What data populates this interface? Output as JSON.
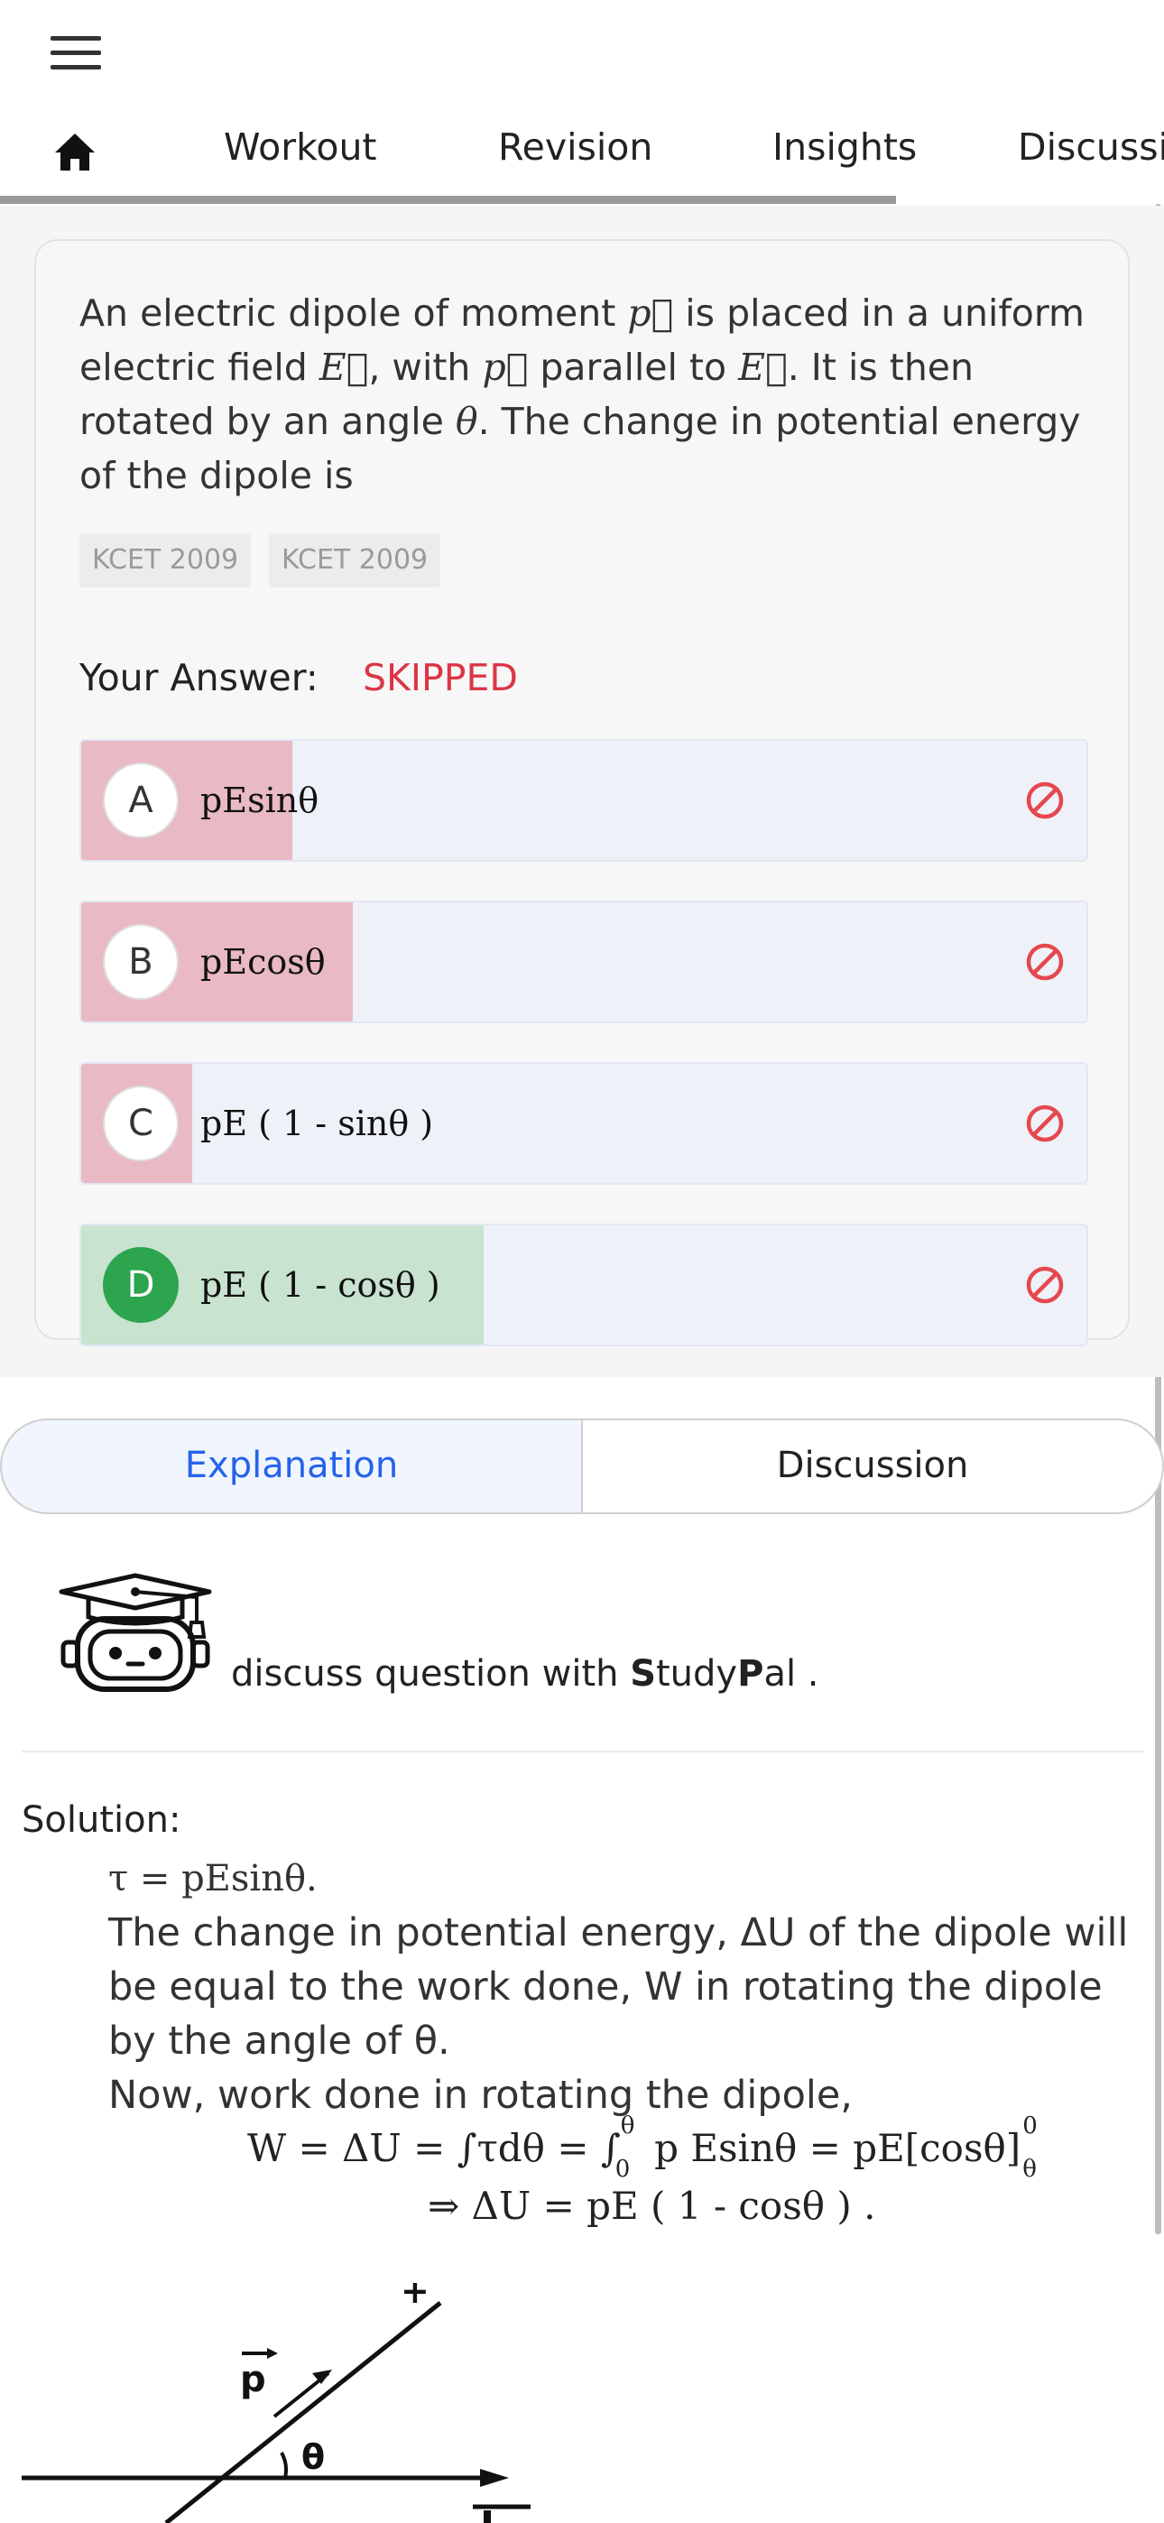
{
  "header": {
    "menu_icon": "hamburger-menu-icon",
    "home_icon": "home-icon",
    "tabs": [
      {
        "label": "Workout"
      },
      {
        "label": "Revision"
      },
      {
        "label": "Insights"
      },
      {
        "label": "Discussi"
      }
    ],
    "tab_progress": 0.77
  },
  "question": {
    "text_parts": [
      "An electric dipole of moment",
      "is placed in a uniform electric field",
      ", with",
      "parallel to",
      ". It is then rotated by an angle",
      ". The change in potential energy of the dipole is"
    ],
    "symbols": {
      "p": "p⃗",
      "E": "E⃗",
      "theta": "θ"
    },
    "tags": [
      "KCET 2009",
      "KCET 2009"
    ],
    "your_answer_label": "Your Answer:",
    "your_answer_value": "SKIPPED"
  },
  "options": [
    {
      "letter": "A",
      "text": "pEsinθ",
      "fill": 0.21,
      "fill_color": "#e9b9c4",
      "correct": false
    },
    {
      "letter": "B",
      "text": "pEcosθ",
      "fill": 0.27,
      "fill_color": "#e9b9c4",
      "correct": false
    },
    {
      "letter": "C",
      "text": "pE ( 1 - sinθ )",
      "fill": 0.11,
      "fill_color": "#e9b9c4",
      "correct": false
    },
    {
      "letter": "D",
      "text": "pE ( 1 - cosθ )",
      "fill": 0.4,
      "fill_color": "#c8e3d0",
      "correct": true
    }
  ],
  "option_icon": "ban-icon",
  "segments": {
    "explanation": "Explanation",
    "discussion": "Discussion"
  },
  "studypal": {
    "icon": "robot-graduate-icon",
    "prefix": "discuss question with ",
    "s": "S",
    "tudy": "tudy",
    "p": "P",
    "al": "al ."
  },
  "solution": {
    "label": "Solution:",
    "line1": "τ = pEsinθ.",
    "line2": "The change in potential energy, ΔU of the dipole will be equal to the work done, W in rotating the dipole by the angle of θ.",
    "line3": "Now, work done in rotating the dipole,",
    "eq1": "W = ΔU = ∫τdθ = ∫",
    "eq1_upper": "θ",
    "eq1_lower": "0",
    "eq1_rest": " p Esinθ = pE[cosθ]",
    "eq1_sup": "0",
    "eq1_sub": "θ",
    "eq2": "⇒ ΔU = pE ( 1 - cosθ ) .",
    "figure": {
      "p_label": "p",
      "theta_label": "θ",
      "plus_label": "+"
    }
  },
  "colors": {
    "accent": "#2563eb",
    "skipped": "#dc3545",
    "correct": "#2da44e",
    "wrong_fill": "#e9b9c4",
    "correct_fill": "#c8e3d0",
    "ban": "#e5484d"
  }
}
